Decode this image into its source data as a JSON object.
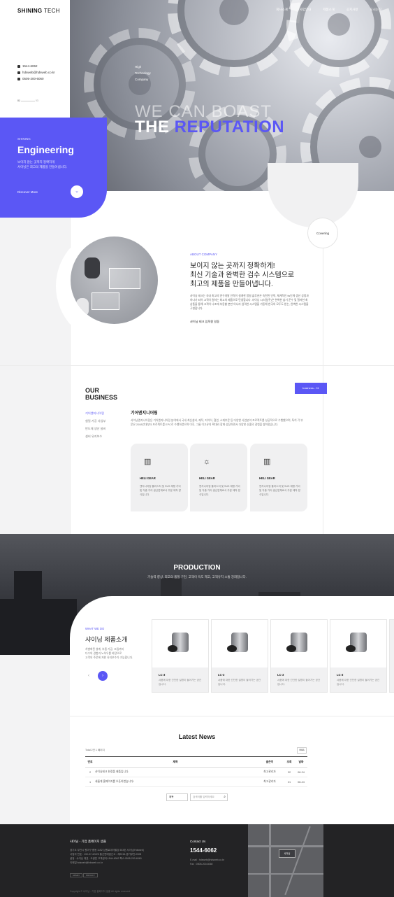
{
  "header": {
    "logo_bold": "SHINING",
    "logo_light": " TECH",
    "nav": [
      "회사소개",
      "사업안내",
      "제품소개",
      "공지사항",
      "오시는길"
    ]
  },
  "contact": {
    "phone": "1544-6062",
    "email": "hdsweb@hdsweb.co.kr",
    "fax": "0505-200-6060"
  },
  "pager": {
    "current": "01",
    "total": "03"
  },
  "hero": {
    "sub": [
      "High",
      "Technology",
      "Company"
    ],
    "line1": "WE CAN BOAST",
    "line2a": "THE ",
    "line2b": "REPUTATION"
  },
  "engineering": {
    "kicker": "SHINING",
    "title": "Engineering",
    "desc1": "보이지 않는 곳까지 정확하게",
    "desc2": "샤이닝은 최고의 제품을 만들어냅니다.",
    "more": "Discover More"
  },
  "covering": "Covering",
  "about": {
    "kicker": "ABOUT COMPANY",
    "h1": "보이지 않는 곳까지 정확하게!",
    "h2": "최신 기술과 완벽한 검수 시스템으로",
    "h3": "최고의 제품을 만들어냅니다.",
    "p": "샤이닝 테크는 국내 최고의 연구개발 인력이 설계한 정밀 솔루션은 숙련된 인력, 체계적인 tis단계 생산 공정과 하나가 되어 고객이 원하는 최고의 제품으로 탄생합니다. 샤이닝 시스템(주)은 완벽한 납기 준수 및 철저한 최상품을 통해 고객이 나조에 부응할 뿐만 아니라 엄격한 시스템을 가동해 한국의 모두도 받는, 완벽한 시스템을 구현합니다.",
    "sign": "샤이닝 테크 임직원 일동"
  },
  "business": {
    "h1": "OUR",
    "h2": "BUSINESS",
    "tab": "business - 01",
    "menu": [
      "기어엔지니어링",
      "첨밀 가공 사업부",
      "반도체 생산 설비",
      "설비 유지보수"
    ],
    "title": "기어엔지니어링",
    "p": "샤이닝엔지니어링은 기어엔지니어링 분야에서 국내 최신설비, 제작, 지이어, 협업, 소재부문 등 다양한 사업분야 프로젝트를 성공적으로 수행했으며, 특히 각 부문은 2008년대부터 프로젝트를 EPC로 수행하였으며 이후, 그룹 이고유의 확대와 함께 성장하면서 다양한 산출의 경험을 쌓아왔습니다.",
    "cards": [
      {
        "icon": "chart-icon",
        "glyph": "▥",
        "title": "HELI GEAR",
        "desc": "엔지니어링 플러스치 및 SUS 재형 가이 및 각종 가이 생산업체로서 주문 제작 방식입니다."
      },
      {
        "icon": "bulb-icon",
        "glyph": "☼",
        "title": "HELI GEAR",
        "desc": "엔지니어링 플러스치 및 SUS 재형 가이 및 각종 가이 생산업체로서 주문 제작 방식입니다."
      },
      {
        "icon": "chart-icon",
        "glyph": "▥",
        "title": "HELI GEAR",
        "desc": "엔지니어링 플러스치 및 SUS 재형 가이 및 각종 가이 생산업체로서 주문 제작 방식입니다."
      }
    ]
  },
  "production": {
    "title": "PRODUCTION",
    "sub": "기술력 향상, 최고의 품질 구현, 고객이 욕도 제고, 고객유치 소통 강화합니다."
  },
  "what": {
    "kicker": "WHAT WE DO",
    "title": "샤이닝 제품소개",
    "p1": "차별화된 설계, 부품 가공, 조립까지",
    "p2": "다수의 경험과 노하우를 바탕으로",
    "p3": "고객의 주문에 저한 유지보수가 가능합니다.",
    "products": [
      {
        "title": "LC-3",
        "desc": "샤품에 대한 간단한 설명이 들어가는 공간입니다."
      },
      {
        "title": "LC-3",
        "desc": "샤품에 대한 간단한 설명이 들어가는 공간입니다."
      },
      {
        "title": "LC-3",
        "desc": "샤품에 대한 간단한 설명이 들어가는 공간입니다."
      },
      {
        "title": "LC-3",
        "desc": "샤품에 대한 간단한 설명이 들어가는 공간입니다."
      }
    ]
  },
  "news": {
    "title": "Latest News",
    "total": "Total 2건 1 페이지",
    "rss": "RSS",
    "cols": [
      "번호",
      "제목",
      "글쓴이",
      "조회",
      "날짜"
    ],
    "rows": [
      {
        "no": "2",
        "title": "샤이닝테크 한정품 제품입니다.",
        "author": "최고관리자",
        "views": "32",
        "date": "08-24"
      },
      {
        "no": "1",
        "title": "새롭게 홈페이지를 오픈하였습니다!",
        "author": "최고관리자",
        "views": "21",
        "date": "08-24"
      }
    ],
    "search_select": "제목",
    "search_placeholder": "검색어를 입력하세요"
  },
  "footer": {
    "company": "샤이닝 - 기업 홈페이지 샘플",
    "lines": [
      "경기도 부천시 원미구 중동 1152 심원로데이필딩 503호 샤이닝(Hdsweb)",
      "사업자 번호 : 130-37-42223 통신판매업신고 : 제2015-경기부천-0308",
      "설정 : 샤이닝 대표 : 오광민 고객센터:1544-6062 팩스:0505-200-6060",
      "이메일:hdsweb@hdsweb.co.kr"
    ],
    "btn1": "ADMIN",
    "btn2": "PRIVACY",
    "contact_label": "Contact Us",
    "phone": "1544-6062",
    "email": "E-mail : hdsweb@hdsweb.co.kr",
    "fax": "Fax : 0505-200-6060",
    "map_label": "샤이닝",
    "copy": "Copyright © 샤이닝 - 기업 홈페이지 샘플 All rights reserved."
  },
  "colors": {
    "accent": "#5b57f5",
    "footer": "#232325"
  }
}
